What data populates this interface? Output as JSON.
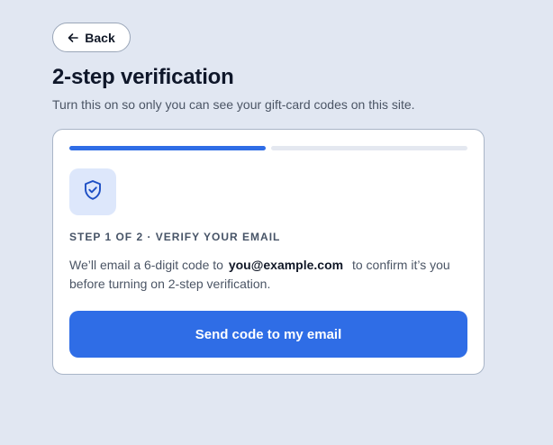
{
  "header": {
    "back_label": "Back",
    "title": "2-step verification",
    "subtitle": "Turn this on so only you can see your gift-card codes on this site."
  },
  "card": {
    "progress": {
      "current_step": 1,
      "total_steps": 2
    },
    "icon": "shield-check-icon",
    "step_label": "STEP 1 OF 2 · VERIFY YOUR EMAIL",
    "description_prefix": "We’ll email a 6-digit code to",
    "email": "you@example.com",
    "description_suffix": "to confirm it’s you before turning on 2-step verification.",
    "send_button_label": "Send code to my email"
  },
  "colors": {
    "background": "#e1e7f2",
    "accent": "#2f6de6",
    "icon_tile": "#dde7fb",
    "progress_inactive": "#e4e8f0"
  }
}
